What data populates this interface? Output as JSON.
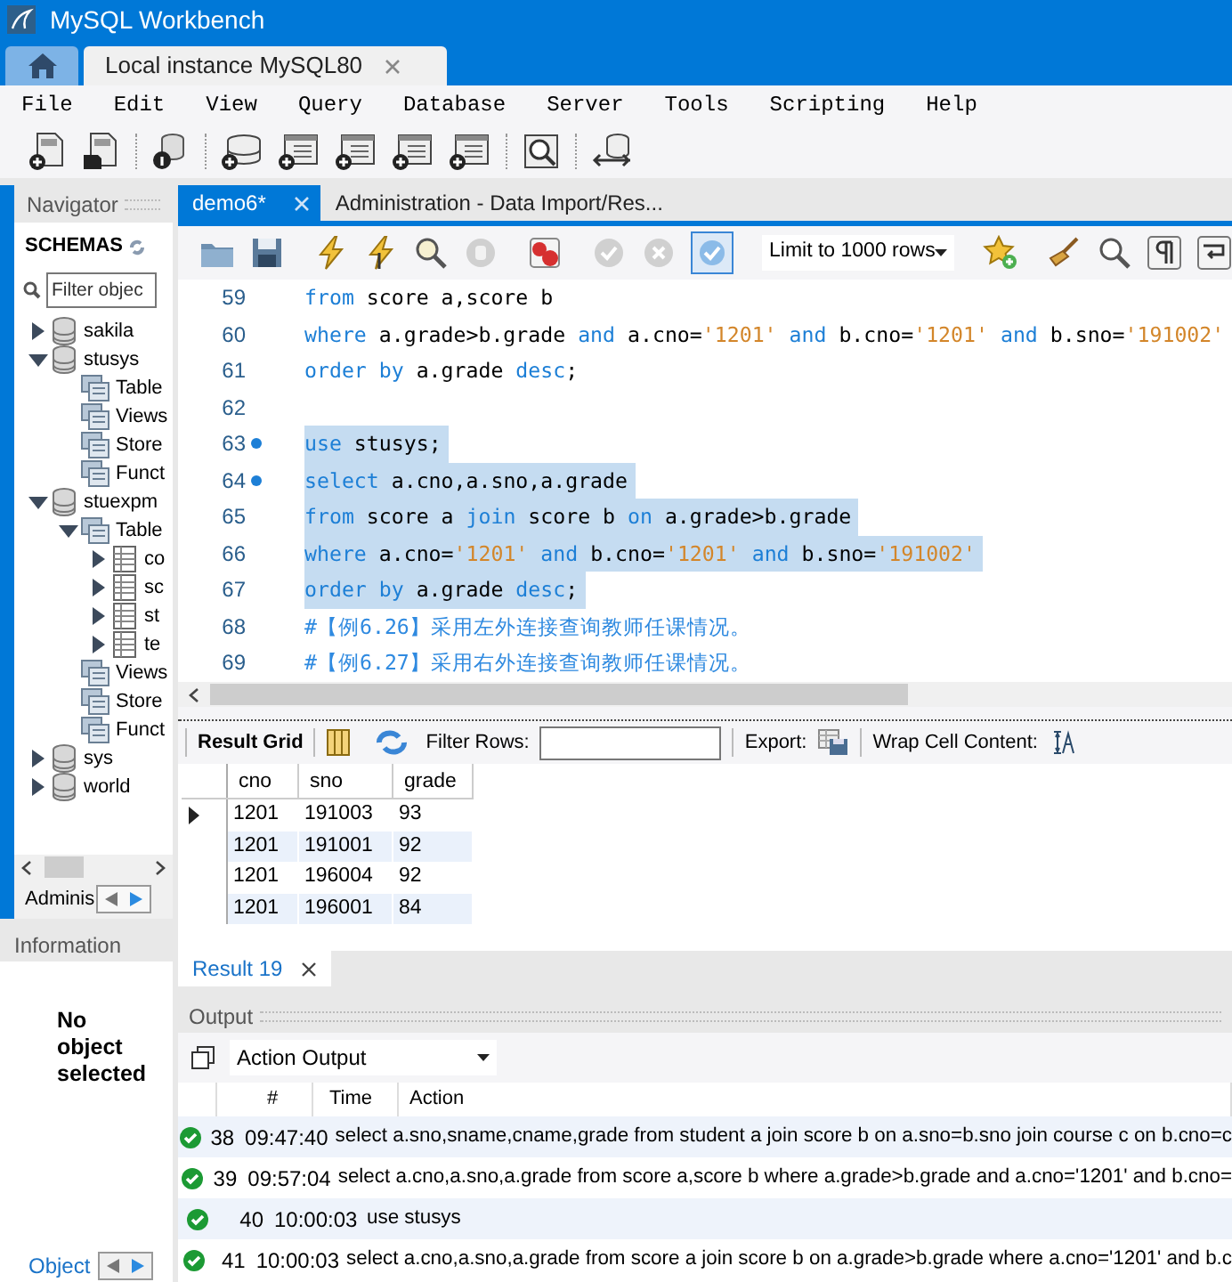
{
  "window": {
    "title": "MySQL Workbench"
  },
  "connection_tabs": [
    {
      "label": "Local instance MySQL80",
      "selected": true
    }
  ],
  "menu": [
    "File",
    "Edit",
    "View",
    "Query",
    "Database",
    "Server",
    "Tools",
    "Scripting",
    "Help"
  ],
  "navigator": {
    "title": "Navigator",
    "section": "SCHEMAS",
    "filter_placeholder": "Filter objec",
    "tree": [
      {
        "label": "sakila",
        "kind": "schema",
        "expanded": false
      },
      {
        "label": "stusys",
        "kind": "schema",
        "expanded": true,
        "children": [
          {
            "label": "Table",
            "kind": "folder"
          },
          {
            "label": "Views",
            "kind": "folder"
          },
          {
            "label": "Store",
            "kind": "folder"
          },
          {
            "label": "Funct",
            "kind": "folder"
          }
        ]
      },
      {
        "label": "stuexpm",
        "kind": "schema",
        "expanded": true,
        "children": [
          {
            "label": "Table",
            "kind": "folder",
            "expanded": true,
            "children": [
              {
                "label": "co",
                "kind": "table",
                "expanded": false
              },
              {
                "label": "sc",
                "kind": "table",
                "expanded": false
              },
              {
                "label": "st",
                "kind": "table",
                "expanded": false
              },
              {
                "label": "te",
                "kind": "table",
                "expanded": false
              }
            ]
          },
          {
            "label": "Views",
            "kind": "folder"
          },
          {
            "label": "Store",
            "kind": "folder"
          },
          {
            "label": "Funct",
            "kind": "folder"
          }
        ]
      },
      {
        "label": "sys",
        "kind": "schema",
        "expanded": false
      },
      {
        "label": "world",
        "kind": "schema",
        "expanded": false
      }
    ],
    "bottom_tab": "Adminis"
  },
  "information": {
    "title": "Information",
    "message": "No object selected",
    "bottom_tab": "Object"
  },
  "editor": {
    "tabs": [
      {
        "label": "demo6*",
        "selected": true
      },
      {
        "label": "Administration - Data Import/Res...",
        "selected": false
      }
    ],
    "limit": "Limit to 1000 rows",
    "lines": [
      {
        "number": "59",
        "selected": false,
        "marker": false,
        "segments": [
          {
            "text": "from",
            "kind": "keyword"
          },
          {
            "text": " score a,score b",
            "kind": "plain"
          }
        ]
      },
      {
        "number": "60",
        "selected": false,
        "marker": false,
        "segments": [
          {
            "text": "where",
            "kind": "keyword"
          },
          {
            "text": " a.grade>b.grade ",
            "kind": "plain"
          },
          {
            "text": "and",
            "kind": "keyword"
          },
          {
            "text": " a.cno=",
            "kind": "plain"
          },
          {
            "text": "'1201'",
            "kind": "string"
          },
          {
            "text": " and",
            "kind": "keyword"
          },
          {
            "text": " b.cno=",
            "kind": "plain"
          },
          {
            "text": "'1201'",
            "kind": "string"
          },
          {
            "text": " and",
            "kind": "keyword"
          },
          {
            "text": " b.sno=",
            "kind": "plain"
          },
          {
            "text": "'191002'",
            "kind": "string"
          }
        ]
      },
      {
        "number": "61",
        "selected": false,
        "marker": false,
        "segments": [
          {
            "text": "order by",
            "kind": "keyword"
          },
          {
            "text": " a.grade ",
            "kind": "plain"
          },
          {
            "text": "desc",
            "kind": "keyword"
          },
          {
            "text": ";",
            "kind": "plain"
          }
        ]
      },
      {
        "number": "62",
        "selected": false,
        "marker": false
      },
      {
        "number": "63",
        "selected": true,
        "marker": true,
        "segments": [
          {
            "text": "use",
            "kind": "keyword"
          },
          {
            "text": " stusys;",
            "kind": "plain"
          }
        ]
      },
      {
        "number": "64",
        "selected": true,
        "marker": true,
        "segments": [
          {
            "text": "select",
            "kind": "keyword"
          },
          {
            "text": " a.cno,a.sno,a.grade",
            "kind": "plain"
          }
        ]
      },
      {
        "number": "65",
        "selected": true,
        "marker": false,
        "segments": [
          {
            "text": "from",
            "kind": "keyword"
          },
          {
            "text": " score a ",
            "kind": "plain"
          },
          {
            "text": "join",
            "kind": "keyword"
          },
          {
            "text": " score b ",
            "kind": "plain"
          },
          {
            "text": "on",
            "kind": "keyword"
          },
          {
            "text": " a.grade>b.grade",
            "kind": "plain"
          }
        ]
      },
      {
        "number": "66",
        "selected": true,
        "marker": false,
        "segments": [
          {
            "text": "where",
            "kind": "keyword"
          },
          {
            "text": " a.cno=",
            "kind": "plain"
          },
          {
            "text": "'1201'",
            "kind": "string"
          },
          {
            "text": " and",
            "kind": "keyword"
          },
          {
            "text": " b.cno=",
            "kind": "plain"
          },
          {
            "text": "'1201'",
            "kind": "string"
          },
          {
            "text": " and",
            "kind": "keyword"
          },
          {
            "text": " b.sno=",
            "kind": "plain"
          },
          {
            "text": "'191002'",
            "kind": "string"
          }
        ]
      },
      {
        "number": "67",
        "selected": true,
        "marker": false,
        "segments": [
          {
            "text": "order by",
            "kind": "keyword"
          },
          {
            "text": " a.grade ",
            "kind": "plain"
          },
          {
            "text": "desc",
            "kind": "keyword"
          },
          {
            "text": ";",
            "kind": "plain"
          }
        ]
      },
      {
        "number": "68",
        "selected": false,
        "marker": false,
        "segments": [
          {
            "text": "#【例6.26】采用左外连接查询教师任课情况。",
            "kind": "comment"
          }
        ]
      },
      {
        "number": "69",
        "selected": false,
        "marker": false,
        "segments": [
          {
            "text": "#【例6.27】采用右外连接查询教师任课情况。",
            "kind": "comment"
          }
        ]
      }
    ]
  },
  "result": {
    "grid_label": "Result Grid",
    "filter_label": "Filter Rows:",
    "export_label": "Export:",
    "wrap_label": "Wrap Cell Content:",
    "columns": [
      "cno",
      "sno",
      "grade"
    ],
    "rows": [
      {
        "cells": [
          "1201",
          "191003",
          "93"
        ],
        "current": true
      },
      {
        "cells": [
          "1201",
          "191001",
          "92"
        ],
        "current": false
      },
      {
        "cells": [
          "1201",
          "196004",
          "92"
        ],
        "current": false
      },
      {
        "cells": [
          "1201",
          "196001",
          "84"
        ],
        "current": false
      }
    ],
    "tabs": [
      {
        "label": "Result 19",
        "selected": true
      }
    ]
  },
  "output": {
    "title": "Output",
    "mode": "Action Output",
    "columns": [
      "#",
      "Time",
      "Action"
    ],
    "rows": [
      {
        "success": true,
        "number": "38",
        "time": "09:47:40",
        "action": "select a.sno,sname,cname,grade from student a join score b on a.sno=b.sno join course c on b.cno=c"
      },
      {
        "success": true,
        "number": "39",
        "time": "09:57:04",
        "action": "select a.cno,a.sno,a.grade from score a,score b where a.grade>b.grade and a.cno='1201' and b.cno="
      },
      {
        "success": true,
        "number": "40",
        "time": "10:00:03",
        "action": "use stusys"
      },
      {
        "success": true,
        "number": "41",
        "time": "10:00:03",
        "action": "select a.cno,a.sno,a.grade from score a join score b on a.grade>b.grade where a.cno='1201' and b.c"
      }
    ]
  }
}
